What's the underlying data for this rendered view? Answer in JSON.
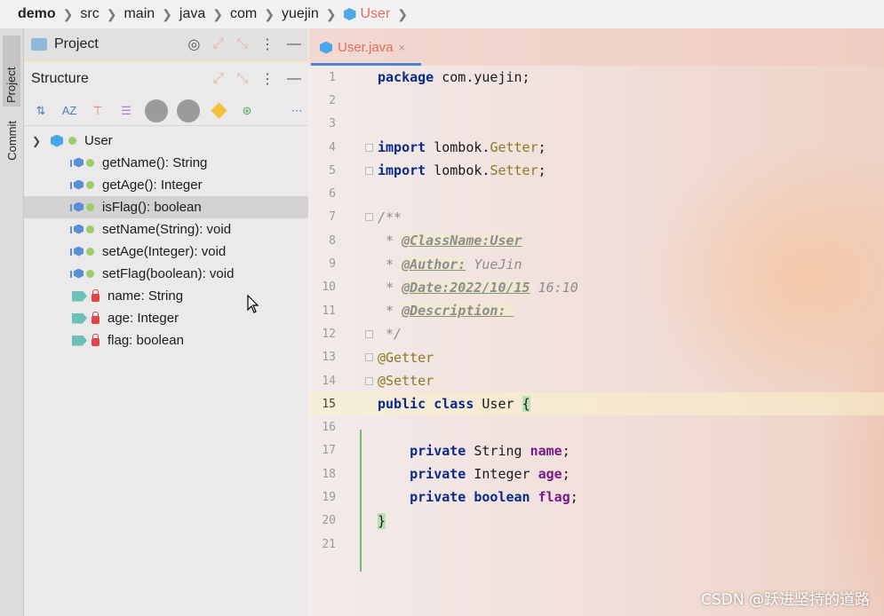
{
  "breadcrumb": [
    "demo",
    "src",
    "main",
    "java",
    "com",
    "yuejin",
    "User"
  ],
  "tool_strip": {
    "project_tab": "Project",
    "commit_tab": "Commit"
  },
  "project_panel": {
    "title": "Project"
  },
  "structure_panel": {
    "title": "Structure",
    "root": "User",
    "items": [
      {
        "kind": "method",
        "label": "getName(): String"
      },
      {
        "kind": "method",
        "label": "getAge(): Integer"
      },
      {
        "kind": "method",
        "label": "isFlag(): boolean",
        "selected": true
      },
      {
        "kind": "method",
        "label": "setName(String): void"
      },
      {
        "kind": "method",
        "label": "setAge(Integer): void"
      },
      {
        "kind": "method",
        "label": "setFlag(boolean): void"
      },
      {
        "kind": "field",
        "label": "name: String"
      },
      {
        "kind": "field",
        "label": "age: Integer"
      },
      {
        "kind": "field",
        "label": "flag: boolean"
      }
    ]
  },
  "editor": {
    "tab_label": "User.java",
    "tab_close": "×",
    "current_line": 15,
    "line_numbers": [
      "1",
      "2",
      "3",
      "4",
      "5",
      "6",
      "7",
      "8",
      "9",
      "10",
      "11",
      "12",
      "13",
      "14",
      "15",
      "16",
      "17",
      "18",
      "19",
      "20",
      "21"
    ],
    "code": {
      "l1_kw": "package",
      "l1_rest": " com.yuejin;",
      "l4_kw": "import",
      "l4_mid": " lombok.",
      "l4_cls": "Getter",
      "l4_end": ";",
      "l5_kw": "import",
      "l5_mid": " lombok.",
      "l5_cls": "Setter",
      "l5_end": ";",
      "l7": "/**",
      "l8_star": " * ",
      "l8_tag": "@ClassName:User",
      "l9_star": " * ",
      "l9_tag": "@Author:",
      "l9_val": " YueJin",
      "l10_star": " * ",
      "l10_tag": "@Date:2022/10/15",
      "l10_val": " 16:10",
      "l11_star": " * ",
      "l11_tag": "@Description: ",
      "l12": " */",
      "l13": "@Getter",
      "l14": "@Setter",
      "l15_kw": "public class",
      "l15_rest": " User ",
      "l15_brace": "{",
      "l17_kw": "private",
      "l17_type": " String ",
      "l17_field": "name",
      "l17_end": ";",
      "l18_kw": "private",
      "l18_type": " Integer ",
      "l18_field": "age",
      "l18_end": ";",
      "l19_kw": "private boolean",
      "l19_field": " flag",
      "l19_end": ";",
      "l20_brace": "}"
    }
  },
  "watermark": "CSDN @跃进坚持的道路",
  "colors": {
    "accent_tab": "#e0705e",
    "selection": "#d3d1d1",
    "keyword": "#0a2a8a",
    "field": "#7a1a8a"
  }
}
